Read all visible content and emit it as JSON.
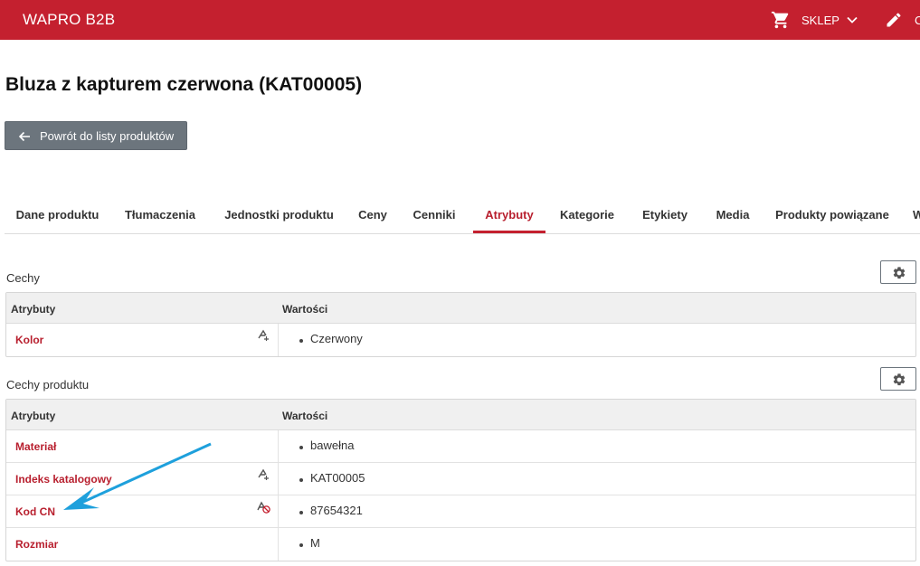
{
  "header": {
    "brand": "WAPRO B2B",
    "shop_label": "SKLEP",
    "cut_text": "C",
    "colors": {
      "bar": "#c4202f",
      "text": "#ffffff"
    }
  },
  "product": {
    "title": "Bluza z kapturem czerwona (KAT00005)",
    "back_label": "Powrót do listy produktów"
  },
  "tabs": [
    {
      "label": "Dane produktu"
    },
    {
      "label": "Tłumaczenia"
    },
    {
      "label": "Jednostki produktu"
    },
    {
      "label": "Ceny"
    },
    {
      "label": "Cenniki"
    },
    {
      "label": "Atrybuty",
      "active": true
    },
    {
      "label": "Kategorie"
    },
    {
      "label": "Etykiety"
    },
    {
      "label": "Media"
    },
    {
      "label": "Produkty powiązane"
    },
    {
      "label": "W"
    }
  ],
  "sections": [
    {
      "label": "Cechy",
      "columns": [
        "Atrybuty",
        "Wartości"
      ],
      "rows": [
        {
          "attr": "Kolor",
          "value": "Czerwony",
          "icon": "translate-icon"
        }
      ]
    },
    {
      "label": "Cechy produktu",
      "columns": [
        "Atrybuty",
        "Wartości"
      ],
      "rows": [
        {
          "attr": "Materiał",
          "value": "bawełna",
          "icon": ""
        },
        {
          "attr": "Indeks katalogowy",
          "value": "KAT00005",
          "icon": "translate-icon"
        },
        {
          "attr": "Kod CN",
          "value": "87654321",
          "icon": "translate-off-icon"
        },
        {
          "attr": "Rozmiar",
          "value": "M",
          "icon": ""
        }
      ]
    }
  ],
  "annotation": {
    "arrow_color": "#1ea0dc"
  }
}
